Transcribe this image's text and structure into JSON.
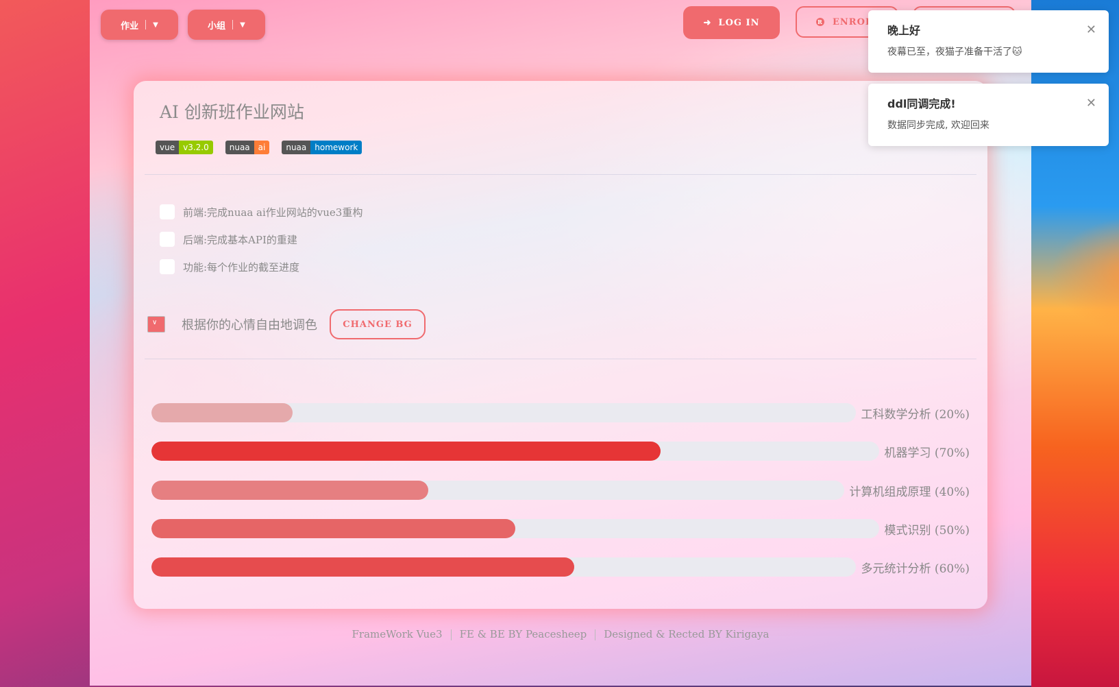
{
  "nav": {
    "homework_label": "作业",
    "group_label": "小组",
    "login_label": "LOG IN",
    "enroll_label": "ENROL"
  },
  "card": {
    "title": "AI 创新班作业网站",
    "badges": [
      {
        "left": "vue",
        "right": "v3.2.0",
        "color": "#97ca00"
      },
      {
        "left": "nuaa",
        "right": "ai",
        "color": "#fe7d37"
      },
      {
        "left": "nuaa",
        "right": "homework",
        "color": "#007ec6"
      }
    ],
    "todos": [
      "前端:完成nuaa ai作业网站的vue3重构",
      "后端:完成基本API的重建",
      "功能:每个作业的截至进度"
    ],
    "color_label": "根据你的心情自由地调色",
    "change_bg_label": "CHANGE BG",
    "accent_color": "#f06a6e"
  },
  "progress": [
    {
      "label": "工科数学分析 (20%)",
      "value": 20,
      "color": "#e5a9ab"
    },
    {
      "label": "机器学习 (70%)",
      "value": 70,
      "color": "#e63536"
    },
    {
      "label": "计算机组成原理 (40%)",
      "value": 40,
      "color": "#e67f81"
    },
    {
      "label": "模式识别 (50%)",
      "value": 50,
      "color": "#e66566"
    },
    {
      "label": "多元统计分析 (60%)",
      "value": 60,
      "color": "#e64c4e"
    }
  ],
  "footer": {
    "framework": "FrameWork Vue3",
    "febe": "FE & BE BY Peacesheep",
    "design": "Designed & Rected BY Kirigaya"
  },
  "toasts": [
    {
      "title": "晚上好",
      "body": "夜幕已至，夜猫子准备干活了🐱"
    },
    {
      "title": "ddl同调完成!",
      "body": "数据同步完成, 欢迎回来"
    }
  ]
}
